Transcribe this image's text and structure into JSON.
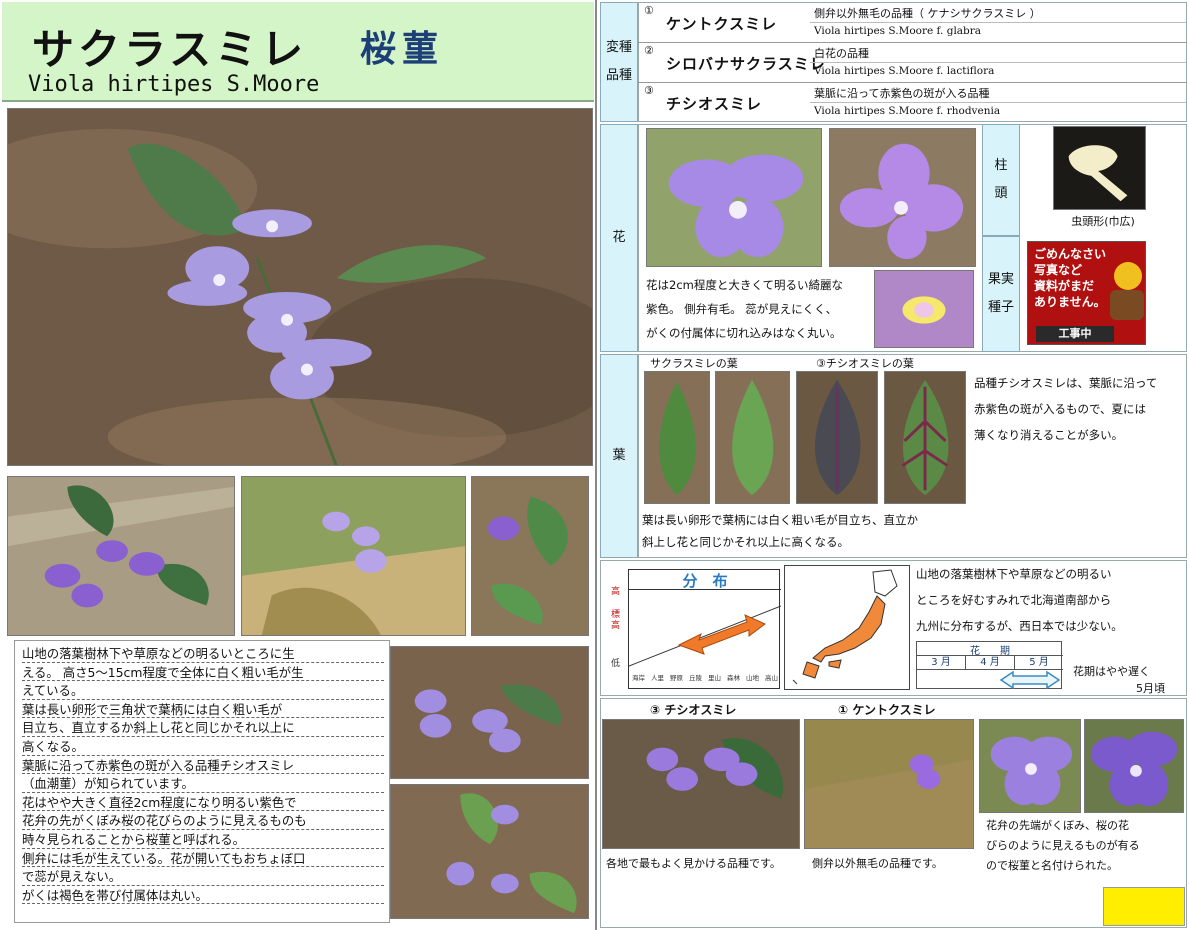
{
  "title": {
    "japanese": "サクラスミレ",
    "kanji": "桜菫",
    "latin": "Viola hirtipes S.Moore"
  },
  "description_lines": [
    "山地の落葉樹林下や草原などの明るいところに生",
    "える。 高さ5～15cm程度で全体に白く粗い毛が生",
    "えている。",
    "葉は長い卵形で三角状で葉柄には白く粗い毛が",
    "目立ち、直立するか斜上し花と同じかそれ以上に",
    "高くなる。",
    "葉脈に沿って赤紫色の斑が入る品種チシオスミレ",
    "（血潮菫）が知られています。",
    "花はやや大きく直径2cm程度になり明るい紫色で",
    "花弁の先がくぼみ桜の花びらのように見えるものも",
    "時々見られることから桜菫と呼ばれる。",
    "側弁には毛が生えている。花が開いてもおちょぼ口",
    "で蕊が見えない。",
    "がくは褐色を帯び付属体は丸い。"
  ],
  "varieties": {
    "label_line1": "変種",
    "label_line2": "品種",
    "items": [
      {
        "num": "①",
        "name": "ケントクスミレ",
        "desc": "側弁以外無毛の品種（ ケナシサクラスミレ ）",
        "latin": "Viola hirtipes S.Moore f. glabra"
      },
      {
        "num": "②",
        "name": "シロバナサクラスミレ",
        "desc": "白花の品種",
        "latin": "Viola hirtipes S.Moore f. lactiflora"
      },
      {
        "num": "③",
        "name": "チシオスミレ",
        "desc": "葉脈に沿って赤紫色の斑が入る品種",
        "latin": "Viola hirtipes S.Moore f. rhodvenia"
      }
    ]
  },
  "flower": {
    "label": "花",
    "text_lines": [
      "花は2cm程度と大きくて明るい綺麗な",
      "紫色。 側弁有毛。 蕊が見えにくく、",
      "がくの付属体に切れ込みはなく丸い。"
    ],
    "stigma_label_1": "柱",
    "stigma_label_2": "頭",
    "stigma_caption": "虫頭形(巾広)",
    "fruit_label_1": "果実",
    "fruit_label_2": "種子",
    "construction_sign": [
      "ごめんなさい",
      "写真など",
      "資料がまだ",
      "ありません。"
    ],
    "construction_badge": "工事中"
  },
  "leaf": {
    "label": "葉",
    "caption_sakura": "サクラスミレの葉",
    "caption_chishio": "③チシオスミレの葉",
    "side_text_lines": [
      "品種チシオスミレは、葉脈に沿って",
      "赤紫色の斑が入るもので、夏には",
      "薄くなり消えることが多い。"
    ],
    "bottom_text_lines": [
      "葉は長い卵形で葉柄には白く粗い毛が目立ち、直立か",
      "斜上し花と同じかそれ以上に高くなる。"
    ]
  },
  "distribution": {
    "title": "分　布",
    "y_axis_top": "高",
    "y_axis_mid": "標高",
    "y_axis_bottom": "低",
    "x_axis": [
      "海岸",
      "人里",
      "野原",
      "丘陵",
      "里山",
      "森林",
      "山地",
      "高山"
    ],
    "text_lines": [
      "山地の落葉樹林下や草原などの明るい",
      "ところを好むすみれで北海道南部から",
      "九州に分布するが、西日本では少ない。"
    ],
    "bloom_title": "花　　期",
    "months": [
      "3 月",
      "4 月",
      "5 月"
    ],
    "bloom_note": "花期はやや遅く",
    "bloom_note2": "5月頃"
  },
  "varieties_photos": {
    "caption_chishio": "③ チシオスミレ",
    "caption_kentoku": "① ケントクスミレ",
    "under_chishio": "各地で最もよく見かける品種です。",
    "under_kentoku": "側弁以外無毛の品種です。",
    "side_text_lines": [
      "花弁の先端がくぼみ、桜の花",
      "びらのように見えるものが有る",
      "ので桜菫と名付けられた。"
    ]
  },
  "colors": {
    "title_bg": "#d4f5c7",
    "kanji_title": "#1c3f78",
    "label_bg": "#d9f3fa",
    "arrow": "#f07a2a",
    "map_shade": "#f08a3a",
    "yellow_box": "#ffee00"
  }
}
